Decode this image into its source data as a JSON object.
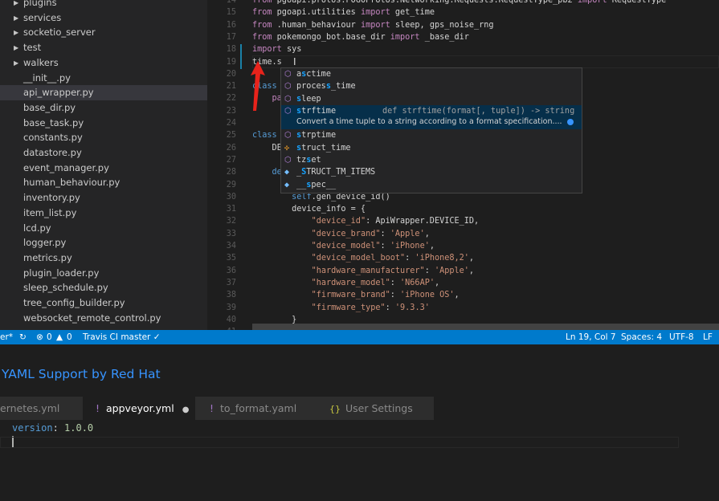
{
  "sidebar": {
    "items": [
      {
        "label": "plugins",
        "folder": true
      },
      {
        "label": "services",
        "folder": true
      },
      {
        "label": "socketio_server",
        "folder": true
      },
      {
        "label": "test",
        "folder": true
      },
      {
        "label": "walkers",
        "folder": true
      },
      {
        "label": "__init__.py"
      },
      {
        "label": "api_wrapper.py",
        "selected": true
      },
      {
        "label": "base_dir.py"
      },
      {
        "label": "base_task.py"
      },
      {
        "label": "constants.py"
      },
      {
        "label": "datastore.py"
      },
      {
        "label": "event_manager.py"
      },
      {
        "label": "human_behaviour.py"
      },
      {
        "label": "inventory.py"
      },
      {
        "label": "item_list.py"
      },
      {
        "label": "lcd.py"
      },
      {
        "label": "logger.py"
      },
      {
        "label": "metrics.py"
      },
      {
        "label": "plugin_loader.py"
      },
      {
        "label": "sleep_schedule.py"
      },
      {
        "label": "tree_config_builder.py"
      },
      {
        "label": "websocket_remote_control.py"
      }
    ]
  },
  "editor": {
    "lines": [
      {
        "n": "14",
        "t": [
          [
            "from ",
            "kw"
          ],
          [
            "pgoapi.protos.POGOProtos.Networking.Requests.RequestType_pb2 ",
            ""
          ],
          [
            "import ",
            "kw"
          ],
          [
            "RequestType",
            ""
          ]
        ]
      },
      {
        "n": "15",
        "t": [
          [
            "from ",
            "kw"
          ],
          [
            "pgoapi.utilities ",
            ""
          ],
          [
            "import ",
            "kw"
          ],
          [
            "get_time",
            ""
          ]
        ]
      },
      {
        "n": "16",
        "t": [
          [
            "from ",
            "kw"
          ],
          [
            ".human_behaviour ",
            ""
          ],
          [
            "import ",
            "kw"
          ],
          [
            "sleep, gps_noise_rng",
            ""
          ]
        ]
      },
      {
        "n": "17",
        "t": [
          [
            "from ",
            "kw"
          ],
          [
            "pokemongo_bot.base_dir ",
            ""
          ],
          [
            "import ",
            "kw"
          ],
          [
            "_base_dir",
            ""
          ]
        ]
      },
      {
        "n": "18",
        "t": [
          [
            "import ",
            "kw"
          ],
          [
            "sys",
            ""
          ]
        ]
      },
      {
        "n": "19",
        "t": [
          [
            "time.s",
            ""
          ]
        ]
      },
      {
        "n": "20",
        "t": []
      },
      {
        "n": "21",
        "t": [
          [
            "class",
            "bl"
          ]
        ]
      },
      {
        "n": "22",
        "t": [
          [
            "    pa",
            "kw"
          ]
        ]
      },
      {
        "n": "23",
        "t": []
      },
      {
        "n": "24",
        "t": []
      },
      {
        "n": "25",
        "t": [
          [
            "class",
            "bl"
          ]
        ]
      },
      {
        "n": "26",
        "t": [
          [
            "    DE",
            ""
          ]
        ]
      },
      {
        "n": "27",
        "t": []
      },
      {
        "n": "28",
        "t": [
          [
            "    de",
            "bl"
          ]
        ]
      },
      {
        "n": "29",
        "t": []
      },
      {
        "n": "30",
        "t": [
          [
            "        ",
            ""
          ],
          [
            "self",
            "bl"
          ],
          [
            ".gen_device_id()",
            ""
          ]
        ]
      },
      {
        "n": "31",
        "t": [
          [
            "        device_info = {",
            ""
          ]
        ]
      },
      {
        "n": "32",
        "t": [
          [
            "            ",
            ""
          ],
          [
            "\"device_id\"",
            "st"
          ],
          [
            ": ApiWrapper.DEVICE_ID,",
            ""
          ]
        ]
      },
      {
        "n": "33",
        "t": [
          [
            "            ",
            ""
          ],
          [
            "\"device_brand\"",
            "st"
          ],
          [
            ": ",
            ""
          ],
          [
            "'Apple'",
            "st"
          ],
          [
            ",",
            ""
          ]
        ]
      },
      {
        "n": "34",
        "t": [
          [
            "            ",
            ""
          ],
          [
            "\"device_model\"",
            "st"
          ],
          [
            ": ",
            ""
          ],
          [
            "'iPhone'",
            "st"
          ],
          [
            ",",
            ""
          ]
        ]
      },
      {
        "n": "35",
        "t": [
          [
            "            ",
            ""
          ],
          [
            "\"device_model_boot\"",
            "st"
          ],
          [
            ": ",
            ""
          ],
          [
            "'iPhone8,2'",
            "st"
          ],
          [
            ",",
            ""
          ]
        ]
      },
      {
        "n": "36",
        "t": [
          [
            "            ",
            ""
          ],
          [
            "\"hardware_manufacturer\"",
            "st"
          ],
          [
            ": ",
            ""
          ],
          [
            "'Apple'",
            "st"
          ],
          [
            ",",
            ""
          ]
        ]
      },
      {
        "n": "37",
        "t": [
          [
            "            ",
            ""
          ],
          [
            "\"hardware_model\"",
            "st"
          ],
          [
            ": ",
            ""
          ],
          [
            "'N66AP'",
            "st"
          ],
          [
            ",",
            ""
          ]
        ]
      },
      {
        "n": "38",
        "t": [
          [
            "            ",
            ""
          ],
          [
            "\"firmware_brand\"",
            "st"
          ],
          [
            ": ",
            ""
          ],
          [
            "'iPhone OS'",
            "st"
          ],
          [
            ",",
            ""
          ]
        ]
      },
      {
        "n": "39",
        "t": [
          [
            "            ",
            ""
          ],
          [
            "\"firmware_type\"",
            "st"
          ],
          [
            ": ",
            ""
          ],
          [
            "'9.3.3'",
            "st"
          ]
        ]
      },
      {
        "n": "40",
        "t": [
          [
            "        }",
            ""
          ]
        ]
      },
      {
        "n": "41",
        "t": []
      }
    ]
  },
  "suggest": {
    "items": [
      {
        "pre": "a",
        "hl": "s",
        "post": "ctime",
        "icon": "method-icon"
      },
      {
        "pre": "proces",
        "hl": "s",
        "post": "_time",
        "icon": "method-icon"
      },
      {
        "pre": "",
        "hl": "s",
        "post": "leep",
        "icon": "method-icon"
      },
      {
        "pre": "",
        "hl": "s",
        "post": "trftime",
        "icon": "method-icon",
        "selected": true,
        "detail": "def strftime(format[, tuple]) -> string"
      },
      {
        "doc": "Convert a time tuple to a string according to a format specification...."
      },
      {
        "pre": "",
        "hl": "s",
        "post": "trptime",
        "icon": "method-icon"
      },
      {
        "pre": "",
        "hl": "s",
        "post": "truct_time",
        "icon": "class-icon"
      },
      {
        "pre": "tz",
        "hl": "s",
        "post": "et",
        "icon": "method-icon"
      },
      {
        "pre": "_",
        "hl": "S",
        "post": "TRUCT_TM_ITEMS",
        "icon": "field-icon"
      },
      {
        "pre": "__",
        "hl": "s",
        "post": "pec__",
        "icon": "field-icon"
      }
    ]
  },
  "status": {
    "branch": "er*",
    "errors": "0",
    "warnings": "0",
    "ci": "Travis CI master ✓",
    "position": "Ln 19, Col 7",
    "spaces": "Spaces: 4",
    "encoding": "UTF-8",
    "eol": "LF"
  },
  "panel": {
    "title": "YAML Support by Red Hat",
    "tabs": [
      {
        "label": "ernetes.yml"
      },
      {
        "label": "appveyor.yml",
        "icon": "!",
        "active": true,
        "dirty": "●"
      },
      {
        "label": "to_format.yaml",
        "icon": "!"
      },
      {
        "label": "User Settings",
        "icon": "{}"
      }
    ],
    "code_key": "version",
    "code_value": "1.0.0"
  },
  "colors": {
    "status_bar": "#007acc",
    "accent": "#3794ff",
    "match": "#18a3ff"
  }
}
